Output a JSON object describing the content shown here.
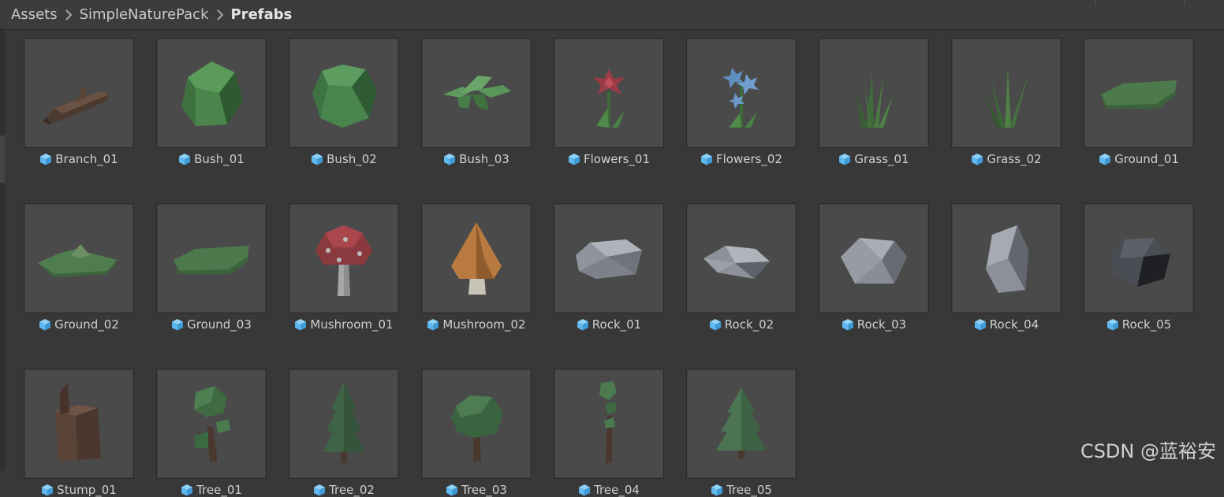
{
  "breadcrumb": {
    "items": [
      "Assets",
      "SimpleNaturePack",
      "Prefabs"
    ]
  },
  "colors": {
    "panel_bg": "#383838",
    "thumb_bg": "#4a4a4a",
    "prefab_icon": "#5fb8ef",
    "label_text": "#cfcfcf"
  },
  "assets": [
    {
      "name": "Branch_01",
      "icon": "prefab-cube-icon",
      "preview": "branch"
    },
    {
      "name": "Bush_01",
      "icon": "prefab-cube-icon",
      "preview": "bush"
    },
    {
      "name": "Bush_02",
      "icon": "prefab-cube-icon",
      "preview": "bush-round"
    },
    {
      "name": "Bush_03",
      "icon": "prefab-cube-icon",
      "preview": "leaves"
    },
    {
      "name": "Flowers_01",
      "icon": "prefab-cube-icon",
      "preview": "flower-red"
    },
    {
      "name": "Flowers_02",
      "icon": "prefab-cube-icon",
      "preview": "flower-blue"
    },
    {
      "name": "Grass_01",
      "icon": "prefab-cube-icon",
      "preview": "grass"
    },
    {
      "name": "Grass_02",
      "icon": "prefab-cube-icon",
      "preview": "grass-2"
    },
    {
      "name": "Ground_01",
      "icon": "prefab-cube-icon",
      "preview": "ground"
    },
    {
      "name": "Ground_02",
      "icon": "prefab-cube-icon",
      "preview": "ground-hill"
    },
    {
      "name": "Ground_03",
      "icon": "prefab-cube-icon",
      "preview": "ground"
    },
    {
      "name": "Mushroom_01",
      "icon": "prefab-cube-icon",
      "preview": "mushroom-red"
    },
    {
      "name": "Mushroom_02",
      "icon": "prefab-cube-icon",
      "preview": "mushroom-orange"
    },
    {
      "name": "Rock_01",
      "icon": "prefab-cube-icon",
      "preview": "rock-flat"
    },
    {
      "name": "Rock_02",
      "icon": "prefab-cube-icon",
      "preview": "rock-slab"
    },
    {
      "name": "Rock_03",
      "icon": "prefab-cube-icon",
      "preview": "rock-boulder"
    },
    {
      "name": "Rock_04",
      "icon": "prefab-cube-icon",
      "preview": "rock-tall"
    },
    {
      "name": "Rock_05",
      "icon": "prefab-cube-icon",
      "preview": "rock-dark"
    },
    {
      "name": "Stump_01",
      "icon": "prefab-cube-icon",
      "preview": "stump"
    },
    {
      "name": "Tree_01",
      "icon": "prefab-cube-icon",
      "preview": "tree-branchy"
    },
    {
      "name": "Tree_02",
      "icon": "prefab-cube-icon",
      "preview": "pine-tall"
    },
    {
      "name": "Tree_03",
      "icon": "prefab-cube-icon",
      "preview": "tree-round"
    },
    {
      "name": "Tree_04",
      "icon": "prefab-cube-icon",
      "preview": "tree-thin"
    },
    {
      "name": "Tree_05",
      "icon": "prefab-cube-icon",
      "preview": "pine"
    }
  ],
  "watermark": "CSDN @蓝裕安"
}
